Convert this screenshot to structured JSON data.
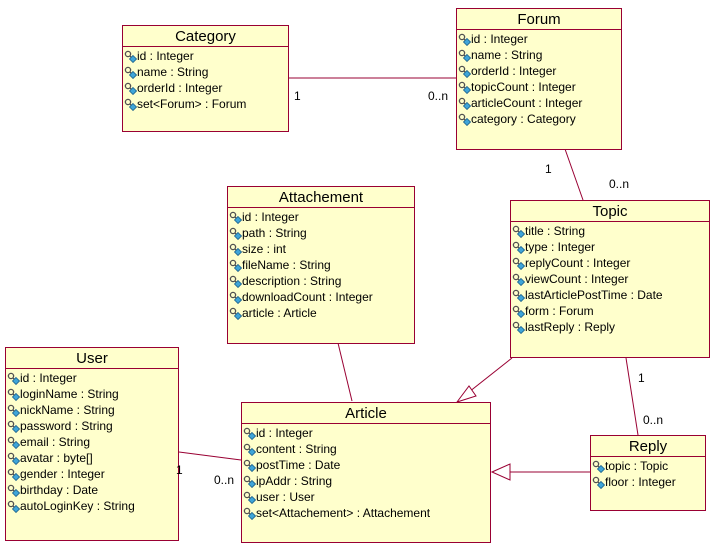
{
  "colors": {
    "class_fill": "#ffffcc",
    "class_border": "#990033",
    "line": "#990033"
  },
  "attribute_icon": "key-diamond-icon",
  "classes": {
    "category": {
      "name": "Category",
      "attributes": [
        "id : Integer",
        "name : String",
        "orderId : Integer",
        "set<Forum> : Forum"
      ]
    },
    "forum": {
      "name": "Forum",
      "attributes": [
        "id : Integer",
        "name : String",
        "orderId : Integer",
        "topicCount : Integer",
        "articleCount : Integer",
        "category : Category"
      ]
    },
    "attachement": {
      "name": "Attachement",
      "attributes": [
        "id : Integer",
        "path : String",
        "size : int",
        "fileName : String",
        "description : String",
        "downloadCount : Integer",
        "article : Article"
      ]
    },
    "topic": {
      "name": "Topic",
      "attributes": [
        "title : String",
        "type : Integer",
        "replyCount : Integer",
        "viewCount : Integer",
        "lastArticlePostTime : Date",
        "form : Forum",
        "lastReply : Reply"
      ]
    },
    "user": {
      "name": "User",
      "attributes": [
        "id : Integer",
        "loginName : String",
        "nickName : String",
        "password : String",
        "email : String",
        "avatar : byte[]",
        "gender : Integer",
        "birthday : Date",
        "autoLoginKey : String"
      ]
    },
    "article": {
      "name": "Article",
      "attributes": [
        "id : Integer",
        "content : String",
        "postTime : Date",
        "ipAddr : String",
        "user : User",
        "set<Attachement> : Attachement"
      ]
    },
    "reply": {
      "name": "Reply",
      "attributes": [
        "topic : Topic",
        "floor : Integer"
      ]
    }
  },
  "relationships": {
    "category_forum": {
      "source_mult": "1",
      "target_mult": "0..n"
    },
    "forum_topic": {
      "source_mult": "1",
      "target_mult": "0..n"
    },
    "topic_reply": {
      "source_mult": "1",
      "target_mult": "0..n"
    },
    "user_article": {
      "source_mult": "1",
      "target_mult": "0..n"
    },
    "attachement_article": {
      "type": "association"
    },
    "topic_article": {
      "type": "generalization"
    },
    "reply_article": {
      "type": "generalization"
    }
  }
}
